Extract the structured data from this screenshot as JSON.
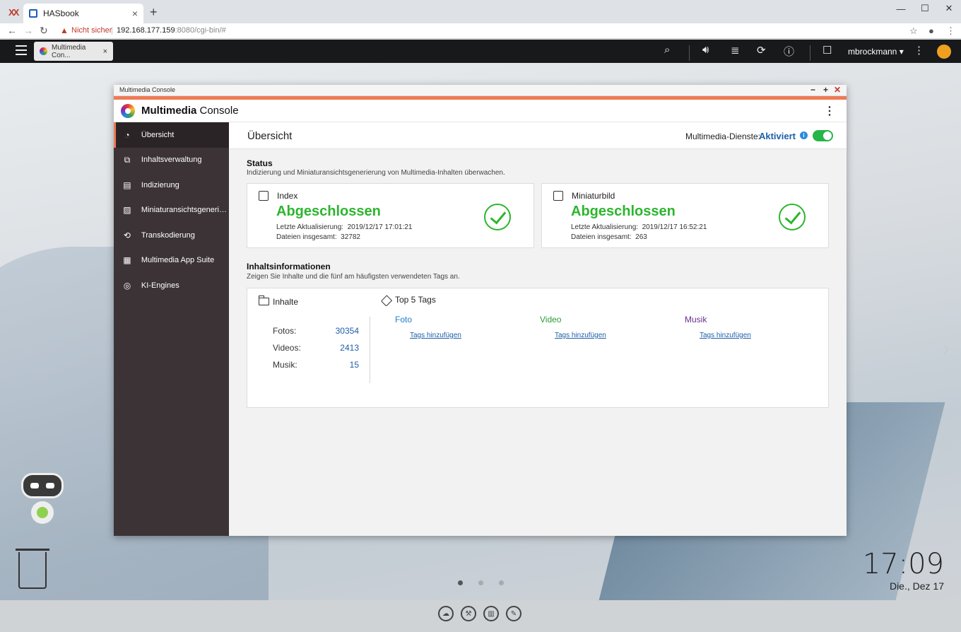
{
  "browser": {
    "tab_title": "HASbook",
    "address_warning": "Nicht sicher",
    "url_host": "192.168.177.159",
    "url_rest": ":8080/cgi-bin/#"
  },
  "qts": {
    "app_tab_label": "Multimedia Con...",
    "username": "mbrockmann ▾"
  },
  "window": {
    "title": "Multimedia Console",
    "app_name_bold": "Multimedia",
    "app_name_rest": " Console"
  },
  "sidebar": {
    "items": [
      {
        "label": "Übersicht",
        "icon": "gauge-icon"
      },
      {
        "label": "Inhaltsverwaltung",
        "icon": "content-manage-icon"
      },
      {
        "label": "Indizierung",
        "icon": "clipboard-icon"
      },
      {
        "label": "Miniaturansichtsgenerierung",
        "icon": "image-icon"
      },
      {
        "label": "Transkodierung",
        "icon": "transcode-icon"
      },
      {
        "label": "Multimedia App Suite",
        "icon": "apps-grid-icon"
      },
      {
        "label": "KI-Engines",
        "icon": "ai-engine-icon"
      }
    ]
  },
  "main": {
    "title": "Übersicht",
    "services_label": "Multimedia-Dienste:",
    "services_value": "Aktiviert",
    "status_title": "Status",
    "status_desc": "Indizierung und Miniaturansichtsgenerierung von Multimedia-Inhalten überwachen.",
    "cards": [
      {
        "title": "Index",
        "status": "Abgeschlossen",
        "updated_label": "Letzte Aktualisierung:",
        "updated": "2019/12/17 17:01:21",
        "files_label": "Dateien insgesamt:",
        "files": "32782"
      },
      {
        "title": "Miniaturbild",
        "status": "Abgeschlossen",
        "updated_label": "Letzte Aktualisierung:",
        "updated": "2019/12/17 16:52:21",
        "files_label": "Dateien insgesamt:",
        "files": "263"
      }
    ],
    "info_title": "Inhaltsinformationen",
    "info_desc": "Zeigen Sie Inhalte und die fünf am häufigsten verwendeten Tags an.",
    "contents_title": "Inhalte",
    "stats": [
      {
        "label": "Fotos:",
        "value": "30354"
      },
      {
        "label": "Videos:",
        "value": "2413"
      },
      {
        "label": "Musik:",
        "value": "15"
      }
    ],
    "tags_title": "Top 5 Tags",
    "tag_columns": [
      {
        "title": "Foto",
        "color": "#1e7fc8",
        "action": "Tags hinzufügen"
      },
      {
        "title": "Video",
        "color": "#2a9d3a",
        "action": "Tags hinzufügen"
      },
      {
        "title": "Musik",
        "color": "#6a2c91",
        "action": "Tags hinzufügen"
      }
    ]
  },
  "desktop": {
    "time": "17:09",
    "date": "Die., Dez 17"
  }
}
